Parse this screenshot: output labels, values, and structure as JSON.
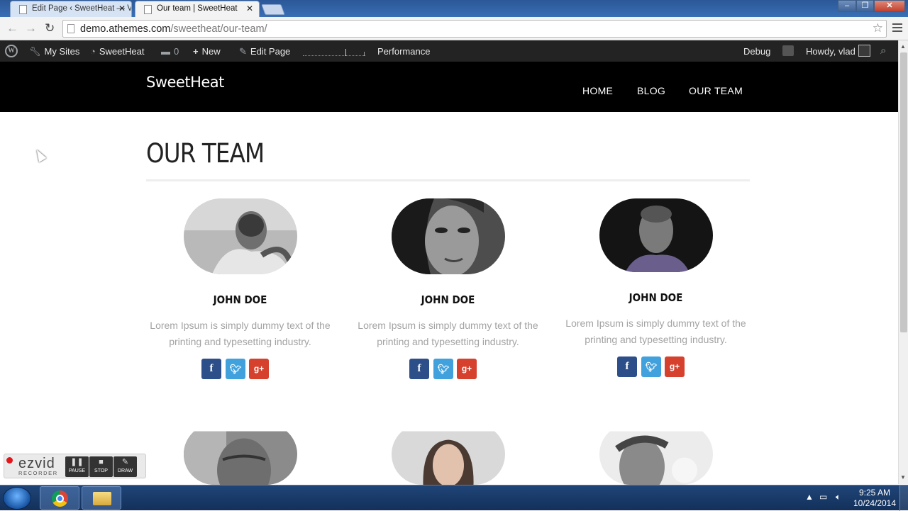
{
  "browser": {
    "tabs": [
      {
        "title": "Edit Page ‹ SweetHeat — V",
        "active": false
      },
      {
        "title": "Our team | SweetHeat",
        "active": true
      }
    ],
    "url_domain": "demo.athemes.com",
    "url_path": "/sweetheat/our-team/"
  },
  "adminbar": {
    "my_sites": "My Sites",
    "site_name": "SweetHeat",
    "comments_count": "0",
    "new_label": "New",
    "edit_page": "Edit Page",
    "performance": "Performance",
    "debug": "Debug",
    "howdy": "Howdy, vlad"
  },
  "site": {
    "title": "SweetHeat",
    "nav": [
      "HOME",
      "BLOG",
      "OUR TEAM"
    ]
  },
  "page": {
    "title": "OUR TEAM"
  },
  "members": [
    {
      "name": "JOHN DOE",
      "bio": "Lorem Ipsum is simply dummy text of the printing and typesetting industry."
    },
    {
      "name": "JOHN DOE",
      "bio": "Lorem Ipsum is simply dummy text of the printing and typesetting industry."
    },
    {
      "name": "JOHN DOE",
      "bio": "Lorem Ipsum is simply dummy text of the printing and typesetting industry."
    }
  ],
  "social_icons": [
    "facebook-icon",
    "twitter-icon",
    "google-plus-icon"
  ],
  "social_colors": {
    "facebook": "#2c4f8a",
    "twitter": "#41a1dd",
    "google_plus": "#d6412d"
  },
  "ezvid": {
    "brand": "ezvid",
    "sub": "RECORDER",
    "buttons": [
      "PAUSE",
      "STOP",
      "DRAW"
    ]
  },
  "taskbar": {
    "time": "9:25 AM",
    "date": "10/24/2014"
  }
}
